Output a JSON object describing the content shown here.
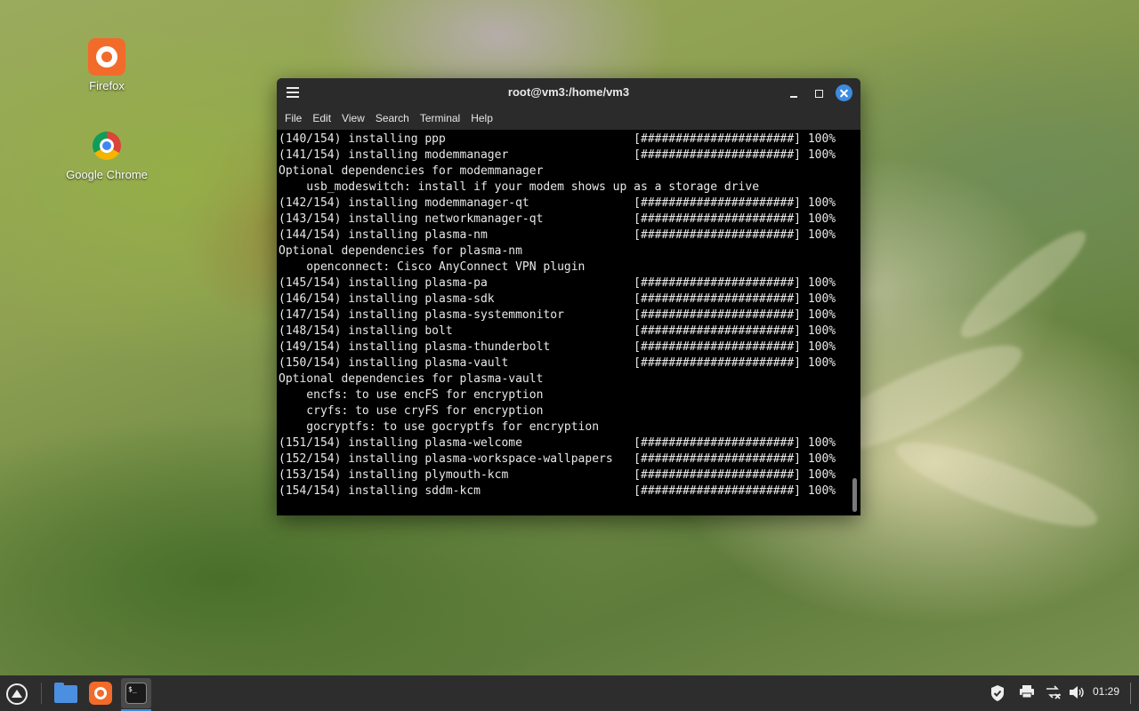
{
  "desktop": {
    "icons": [
      {
        "label": "Firefox",
        "icon": "firefox-icon"
      },
      {
        "label": "Google Chrome",
        "icon": "chrome-icon"
      }
    ]
  },
  "window": {
    "title": "root@vm3:/home/vm3",
    "menu": [
      "File",
      "Edit",
      "View",
      "Search",
      "Terminal",
      "Help"
    ]
  },
  "terminal": {
    "lines": [
      "(140/154) installing ppp                           [######################] 100%",
      "(141/154) installing modemmanager                  [######################] 100%",
      "Optional dependencies for modemmanager",
      "    usb_modeswitch: install if your modem shows up as a storage drive",
      "(142/154) installing modemmanager-qt               [######################] 100%",
      "(143/154) installing networkmanager-qt             [######################] 100%",
      "(144/154) installing plasma-nm                     [######################] 100%",
      "Optional dependencies for plasma-nm",
      "    openconnect: Cisco AnyConnect VPN plugin",
      "(145/154) installing plasma-pa                     [######################] 100%",
      "(146/154) installing plasma-sdk                    [######################] 100%",
      "(147/154) installing plasma-systemmonitor          [######################] 100%",
      "(148/154) installing bolt                          [######################] 100%",
      "(149/154) installing plasma-thunderbolt            [######################] 100%",
      "(150/154) installing plasma-vault                  [######################] 100%",
      "Optional dependencies for plasma-vault",
      "    encfs: to use encFS for encryption",
      "    cryfs: to use cryFS for encryption",
      "    gocryptfs: to use gocryptfs for encryption",
      "(151/154) installing plasma-welcome                [######################] 100%",
      "(152/154) installing plasma-workspace-wallpapers   [######################] 100%",
      "(153/154) installing plymouth-kcm                  [######################] 100%",
      "(154/154) installing sddm-kcm                      [######################] 100%"
    ]
  },
  "taskbar": {
    "clock": "01:29",
    "accent": "#3d8be0"
  }
}
